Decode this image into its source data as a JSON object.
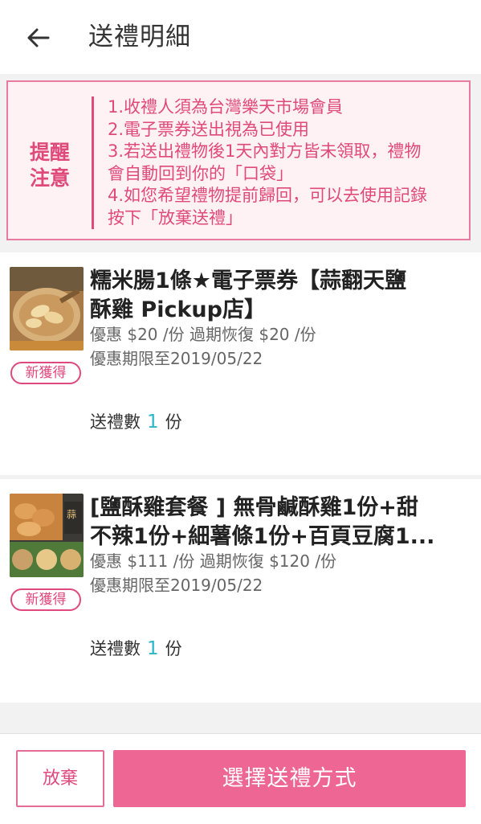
{
  "header": {
    "title": "送禮明細",
    "back_icon": "arrow-left-icon"
  },
  "notice": {
    "label_line1": "提醒",
    "label_line2": "注意",
    "lines": [
      "1.收禮人須為台灣樂天市場會員",
      "2.電子票券送出視為已使用",
      "3.若送出禮物後1天內對方皆未領取，禮物",
      "會自動回到你的「口袋」",
      "4.如您希望禮物提前歸回，可以去使用記錄",
      "按下「放棄送禮」"
    ]
  },
  "items": [
    {
      "title_line1": "糯米腸1條★電子票券【蒜翻天鹽",
      "title_line2": "酥雞 Pickup店】",
      "price": "優惠 $20 /份 過期恢復 $20 /份",
      "expiry": "優惠期限至2019/05/22",
      "badge": "新獲得",
      "qty_label": "送禮數",
      "qty_value": "1",
      "qty_unit": "份"
    },
    {
      "title_line1": "[鹽酥雞套餐 ] 無骨鹹酥雞1份+甜",
      "title_line2": "不辣1份+細薯條1份+百頁豆腐1...",
      "price": "優惠 $111 /份 過期恢復 $120 /份",
      "expiry": "優惠期限至2019/05/22",
      "badge": "新獲得",
      "qty_label": "送禮數",
      "qty_value": "1",
      "qty_unit": "份"
    }
  ],
  "footer": {
    "giveup_label": "放棄",
    "choose_label": "選擇送禮方式"
  },
  "colors": {
    "accent_pink": "#e0497c",
    "button_pink": "#ee6694",
    "qty_teal": "#2bb6c9",
    "notice_bg": "#fff2f5"
  }
}
